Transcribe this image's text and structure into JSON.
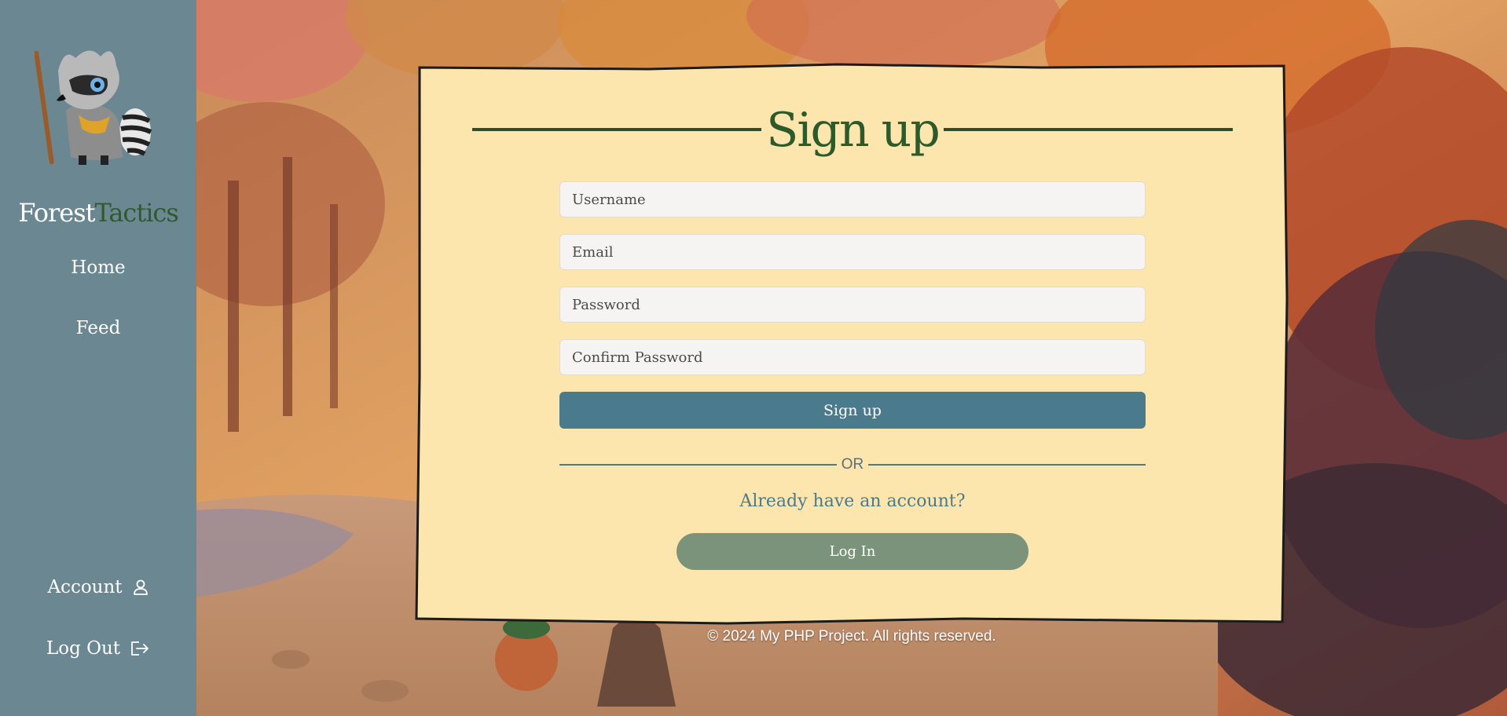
{
  "sidebar": {
    "brand_part1": "Forest",
    "brand_part2": "Tactics",
    "nav": [
      {
        "label": "Home"
      },
      {
        "label": "Feed"
      }
    ],
    "account_label": "Account",
    "logout_label": "Log Out"
  },
  "signup": {
    "title": "Sign up",
    "username_placeholder": "Username",
    "email_placeholder": "Email",
    "password_placeholder": "Password",
    "confirm_placeholder": "Confirm Password",
    "submit_label": "Sign up",
    "or_label": "OR",
    "already_label": "Already have an account?",
    "login_label": "Log In"
  },
  "footer": {
    "text": "© 2024 My PHP Project. All rights reserved."
  },
  "colors": {
    "sidebar": "#6b8892",
    "card": "#fde6ad",
    "accent_blue": "#4a7b8c",
    "accent_green": "#2d5a2b",
    "login_button": "#7a937a"
  }
}
